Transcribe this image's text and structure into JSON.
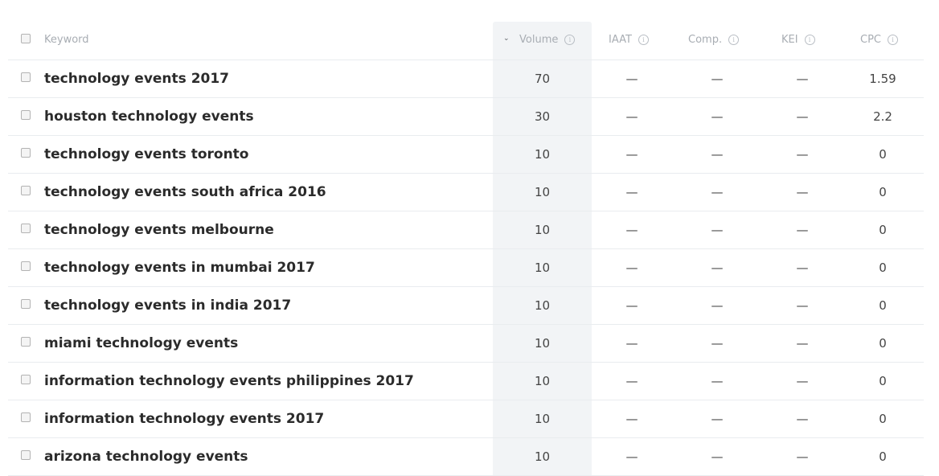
{
  "header": {
    "keyword": "Keyword",
    "volume": "Volume",
    "iaat": "IAAT",
    "comp": "Comp.",
    "kei": "KEI",
    "cpc": "CPC"
  },
  "icons": {
    "info": "info-circle-icon",
    "sort": "sort-descending-icon",
    "checkbox": "checkbox-unchecked"
  },
  "rows": [
    {
      "keyword": "technology events 2017",
      "volume": "70",
      "iaat": "—",
      "comp": "—",
      "kei": "—",
      "cpc": "1.59"
    },
    {
      "keyword": "houston technology events",
      "volume": "30",
      "iaat": "—",
      "comp": "—",
      "kei": "—",
      "cpc": "2.2"
    },
    {
      "keyword": "technology events toronto",
      "volume": "10",
      "iaat": "—",
      "comp": "—",
      "kei": "—",
      "cpc": "0"
    },
    {
      "keyword": "technology events south africa 2016",
      "volume": "10",
      "iaat": "—",
      "comp": "—",
      "kei": "—",
      "cpc": "0"
    },
    {
      "keyword": "technology events melbourne",
      "volume": "10",
      "iaat": "—",
      "comp": "—",
      "kei": "—",
      "cpc": "0"
    },
    {
      "keyword": "technology events in mumbai 2017",
      "volume": "10",
      "iaat": "—",
      "comp": "—",
      "kei": "—",
      "cpc": "0"
    },
    {
      "keyword": "technology events in india 2017",
      "volume": "10",
      "iaat": "—",
      "comp": "—",
      "kei": "—",
      "cpc": "0"
    },
    {
      "keyword": "miami technology events",
      "volume": "10",
      "iaat": "—",
      "comp": "—",
      "kei": "—",
      "cpc": "0"
    },
    {
      "keyword": "information technology events philippines 2017",
      "volume": "10",
      "iaat": "—",
      "comp": "—",
      "kei": "—",
      "cpc": "0"
    },
    {
      "keyword": "information technology events 2017",
      "volume": "10",
      "iaat": "—",
      "comp": "—",
      "kei": "—",
      "cpc": "0"
    },
    {
      "keyword": "arizona technology events",
      "volume": "10",
      "iaat": "—",
      "comp": "—",
      "kei": "—",
      "cpc": "0"
    }
  ]
}
